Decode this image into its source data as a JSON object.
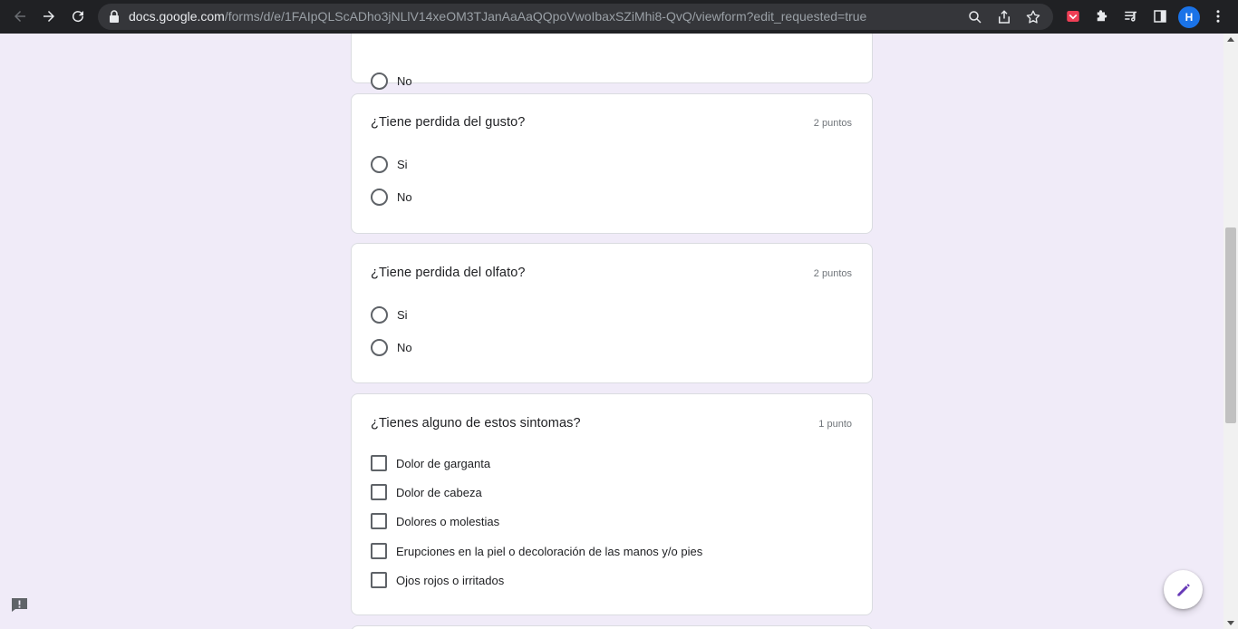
{
  "browser": {
    "url_host": "docs.google.com",
    "url_path": "/forms/d/e/1FAIpQLScADho3jNLlV14xeOM3TJanAaAaQQpoVwoIbaxSZiMhi8-QvQ/viewform?edit_requested=true",
    "profile_initial": "H"
  },
  "form": {
    "partial_card": {
      "options": [
        {
          "label": "No",
          "type": "radio"
        }
      ]
    },
    "questions": [
      {
        "title": "¿Tiene perdida del gusto?",
        "points": "2 puntos",
        "options": [
          {
            "label": "Si"
          },
          {
            "label": "No"
          }
        ]
      },
      {
        "title": "¿Tiene perdida del olfato?",
        "points": "2 puntos",
        "options": [
          {
            "label": "Si"
          },
          {
            "label": "No"
          }
        ]
      },
      {
        "title": "¿Tienes alguno de estos sintomas?",
        "points": "1 punto",
        "options": [
          {
            "label": "Dolor de garganta"
          },
          {
            "label": "Dolor de cabeza"
          },
          {
            "label": "Dolores o molestias"
          },
          {
            "label": "Erupciones en la piel o decoloración de las manos y/o pies"
          },
          {
            "label": "Ojos rojos o irritados"
          }
        ]
      }
    ]
  },
  "icons": {
    "back": "arrow-left-icon",
    "forward": "arrow-right-icon",
    "reload": "reload-icon",
    "zoom": "magnifier-icon",
    "share": "share-icon",
    "bookmark": "star-icon",
    "extension": "puzzle-icon",
    "edit": "pencil-icon",
    "report": "feedback-icon"
  },
  "colors": {
    "page_background": "#f0ebf8",
    "browser_bar": "#202124",
    "accent": "#673ab7",
    "avatar": "#1a73e8"
  }
}
